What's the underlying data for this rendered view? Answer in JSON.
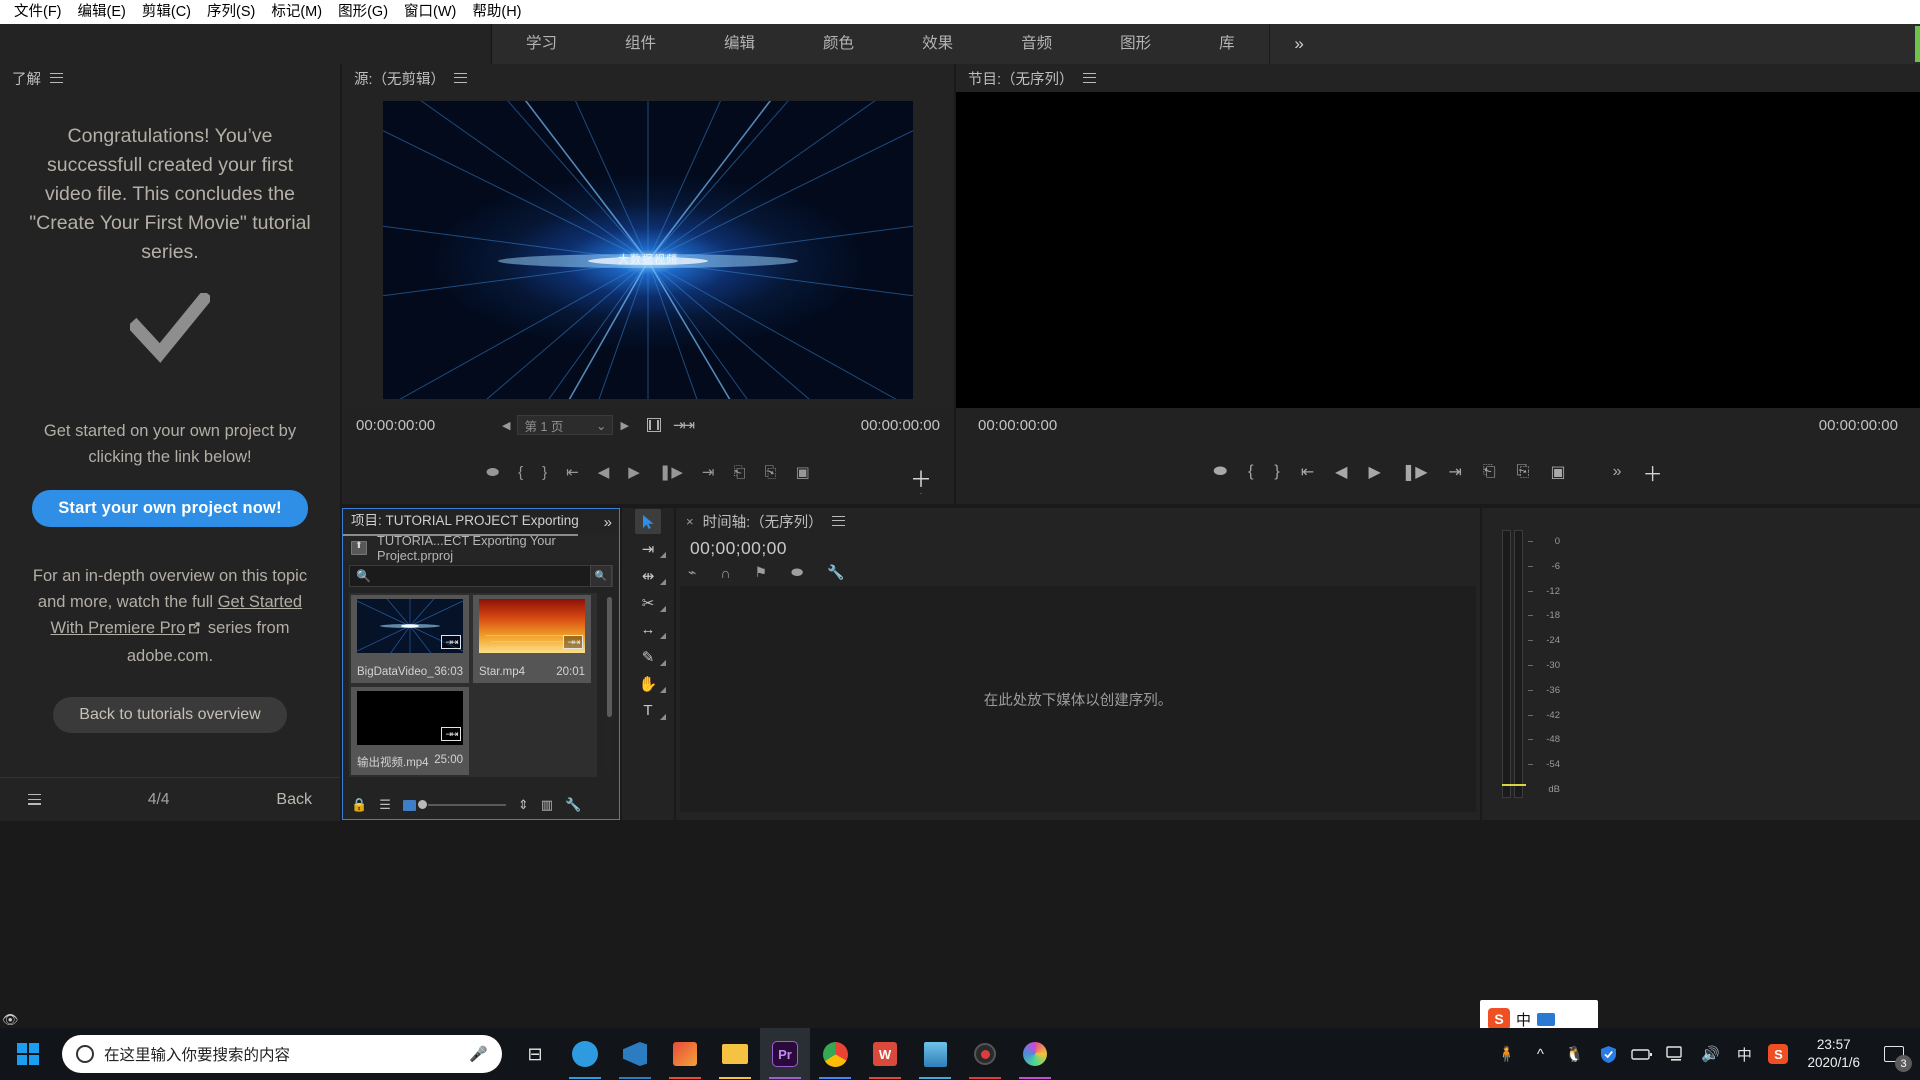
{
  "menubar": {
    "items": [
      {
        "label": "文件(F)",
        "name": "menu-file"
      },
      {
        "label": "编辑(E)",
        "name": "menu-edit"
      },
      {
        "label": "剪辑(C)",
        "name": "menu-clip"
      },
      {
        "label": "序列(S)",
        "name": "menu-sequence"
      },
      {
        "label": "标记(M)",
        "name": "menu-marker"
      },
      {
        "label": "图形(G)",
        "name": "menu-graphics"
      },
      {
        "label": "窗口(W)",
        "name": "menu-window"
      },
      {
        "label": "帮助(H)",
        "name": "menu-help"
      }
    ]
  },
  "workspace": {
    "tabs": [
      "学习",
      "组件",
      "编辑",
      "颜色",
      "效果",
      "音频",
      "图形",
      "库"
    ],
    "overflow": "»"
  },
  "learn": {
    "panel_title": "了解",
    "congrats": "Congratulations! You’ve successfull created your first video file. This concludes the \"Create Your First Movie\" tutorial series.",
    "subtext": "Get started on your own project by clicking the link below!",
    "primary_button": "Start your own project now!",
    "paragraph_pre": "For an in-depth overview on this topic and more, watch the full ",
    "paragraph_link": "Get Started With Premiere Pro",
    "paragraph_post": " series from adobe.com.",
    "secondary_button": "Back to tutorials overview",
    "page_indicator": "4/4",
    "back_label": "Back",
    "accent_color": "#2f8ee6"
  },
  "source_monitor": {
    "title": "源:（无剪辑）",
    "video_title": "大数据视频",
    "timecode_left": "00:00:00:00",
    "timecode_right": "00:00:00:00",
    "page_select": "第 1 页",
    "prev_arrow": "◀",
    "next_arrow": "▶"
  },
  "program_monitor": {
    "title": "节目:（无序列）",
    "timecode_left": "00:00:00:00",
    "timecode_right": "00:00:00:00",
    "overflow": "»"
  },
  "project": {
    "tab_title": "项目: TUTORIAL PROJECT Exporting Your Pr",
    "breadcrumb": "TUTORIA...ECT Exporting Your Project.prproj",
    "search_placeholder": "",
    "overflow": "»",
    "items": [
      {
        "name": "BigDataVideo_",
        "duration": "36:03",
        "kind": "video"
      },
      {
        "name": "Star.mp4",
        "duration": "20:01",
        "kind": "video"
      },
      {
        "name": "输出视频.mp4",
        "duration": "25:00",
        "kind": "video"
      }
    ]
  },
  "timeline": {
    "title": "时间轴:（无序列）",
    "timecode": "00;00;00;00",
    "drop_hint": "在此处放下媒体以创建序列。"
  },
  "audio_meters": {
    "ticks": [
      "0",
      "-6",
      "-12",
      "-18",
      "-24",
      "-30",
      "-36",
      "-42",
      "-48",
      "-54",
      "dB"
    ]
  },
  "ime": {
    "logo": "S",
    "text": "中"
  },
  "taskbar": {
    "search_placeholder": "在这里输入你要搜索的内容",
    "apps": [
      {
        "name": "taskview",
        "label": "⊟"
      },
      {
        "name": "cortana",
        "label": "",
        "color": "#2e9ae0"
      },
      {
        "name": "vscode",
        "label": "",
        "color": "#2b7cc1"
      },
      {
        "name": "store",
        "label": "",
        "color": "#e84b3a"
      },
      {
        "name": "explorer",
        "label": "",
        "color": "#f5c242"
      },
      {
        "name": "premiere",
        "label": "Pr",
        "color": "#9b5fd0"
      },
      {
        "name": "chrome",
        "label": "",
        "color": "#4285f4"
      },
      {
        "name": "wps",
        "label": "W",
        "color": "#d94a3d"
      },
      {
        "name": "notes",
        "label": "",
        "color": "#4aa5d9"
      },
      {
        "name": "recorder",
        "label": "",
        "color": "#d93d3d"
      },
      {
        "name": "paint",
        "label": "",
        "color": "#c84ad9"
      }
    ],
    "tray": [
      "people",
      "chevron-up",
      "qq",
      "shield",
      "battery",
      "network",
      "volume",
      "ime-cn",
      "sogou"
    ],
    "clock_time": "23:57",
    "clock_date": "2020/1/6",
    "notification_count": "3"
  }
}
